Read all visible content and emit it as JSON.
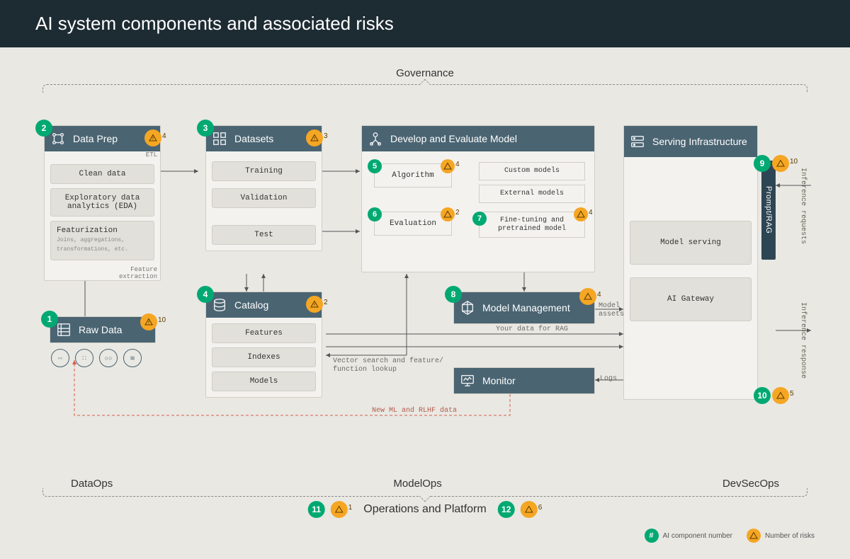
{
  "header": {
    "title": "AI system components and associated risks"
  },
  "governance_label": "Governance",
  "ops": {
    "data": "DataOps",
    "model": "ModelOps",
    "devsec": "DevSecOps",
    "platform": "Operations and Platform"
  },
  "legend": {
    "component": "AI component number",
    "risks": "Number of risks",
    "hash": "#"
  },
  "annotations": {
    "etl": "ETL",
    "feature_extraction": "Feature\nextraction",
    "model_assets": "Model\nassets",
    "your_data_rag": "Your data for RAG",
    "vector_lookup": "Vector search and feature/\nfunction lookup",
    "new_ml_rlhf": "New ML and RLHF data",
    "logs": "Logs",
    "inference_req": "Inference requests",
    "inference_resp": "Inference response"
  },
  "components": {
    "raw_data": {
      "num": "1",
      "risks": "10",
      "title": "Raw Data"
    },
    "data_prep": {
      "num": "2",
      "risks": "4",
      "title": "Data Prep",
      "items": [
        "Clean data",
        "Exploratory data analytics (EDA)",
        "Featurization"
      ],
      "feat_sub": "Joins, aggregations,\ntransformations, etc."
    },
    "datasets": {
      "num": "3",
      "risks": "3",
      "title": "Datasets",
      "items": [
        "Training",
        "Validation",
        "Test"
      ]
    },
    "catalog": {
      "num": "4",
      "risks": "2",
      "title": "Catalog",
      "items": [
        "Features",
        "Indexes",
        "Models"
      ]
    },
    "develop": {
      "title": "Develop and Evaluate Model"
    },
    "algorithm": {
      "num": "5",
      "risks": "4",
      "title": "Algorithm"
    },
    "evaluation": {
      "num": "6",
      "risks": "2",
      "title": "Evaluation"
    },
    "finetune": {
      "num": "7",
      "risks": "4",
      "title": "Fine-tuning and pretrained model"
    },
    "custom_models": {
      "title": "Custom models"
    },
    "external_models": {
      "title": "External models"
    },
    "model_mgmt": {
      "num": "8",
      "risks": "4",
      "title": "Model Management"
    },
    "prompt_rag": {
      "num": "9",
      "risks": "10",
      "title": "Prompt/RAG"
    },
    "responses": {
      "num": "10",
      "risks": "5"
    },
    "ops_platform_left": {
      "num": "11",
      "risks": "1"
    },
    "ops_platform_right": {
      "num": "12",
      "risks": "6"
    },
    "serving": {
      "title": "Serving Infrastructure",
      "items": [
        "Model serving",
        "AI Gateway"
      ]
    },
    "monitor": {
      "title": "Monitor"
    }
  }
}
